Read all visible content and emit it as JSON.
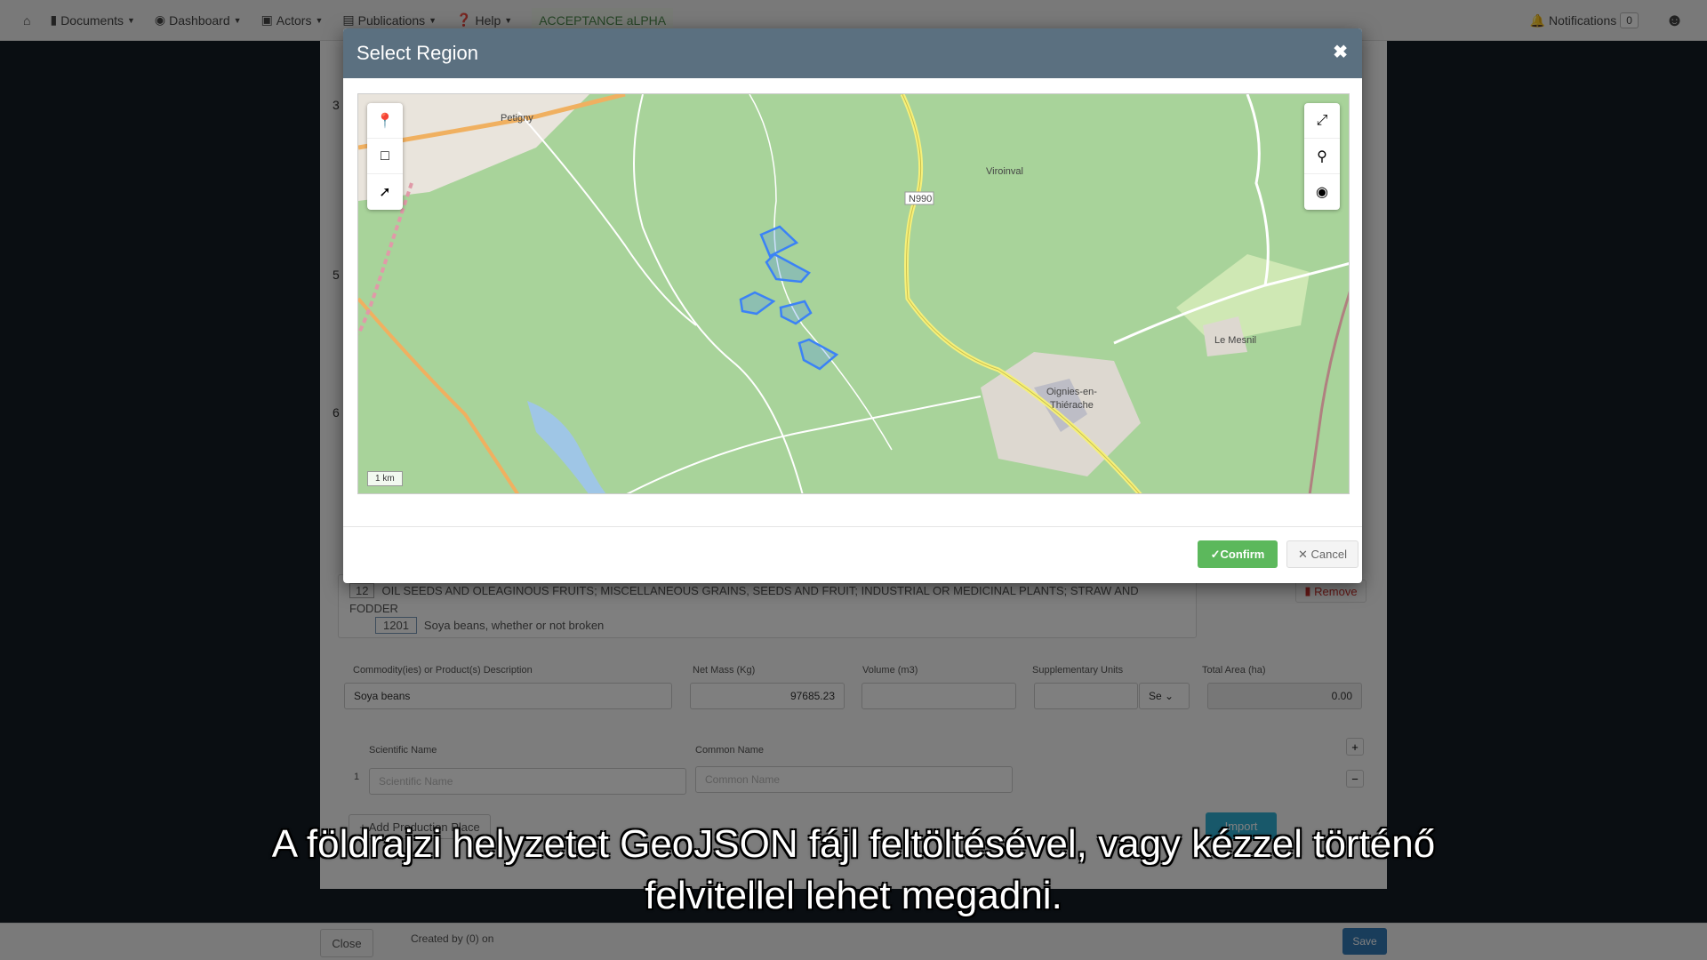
{
  "navbar": {
    "items": [
      {
        "label": "Documents",
        "icon": "file-icon"
      },
      {
        "label": "Dashboard",
        "icon": "dashboard-icon"
      },
      {
        "label": "Actors",
        "icon": "id-card-icon"
      },
      {
        "label": "Publications",
        "icon": "book-icon"
      },
      {
        "label": "Help",
        "icon": "question-icon"
      }
    ],
    "environment": "ACCEPTANCE aLPHA",
    "notifications_label": "Notifications",
    "notifications_count": "0"
  },
  "form": {
    "row_numbers": [
      "3",
      "5",
      "6"
    ],
    "hs_chapter_code": "12",
    "hs_chapter_text": "OIL SEEDS AND OLEAGINOUS FRUITS; MISCELLANEOUS GRAINS, SEEDS AND FRUIT; INDUSTRIAL OR MEDICINAL PLANTS; STRAW AND FODDER",
    "hs_heading_code": "1201",
    "hs_heading_text": "Soya beans, whether or not broken",
    "remove_label": "Remove",
    "labels": {
      "description": "Commodity(ies) or Product(s) Description",
      "net_mass": "Net Mass (Kg)",
      "volume": "Volume (m3)",
      "supplementary_units": "Supplementary Units",
      "total_area": "Total Area (ha)"
    },
    "values": {
      "description": "Soya beans",
      "net_mass": "97685.23",
      "volume": "",
      "supplementary_units": "",
      "supplementary_select": "Se",
      "total_area": "0.00"
    },
    "species": {
      "scientific_header": "Scientific Name",
      "common_header": "Common Name",
      "row_index": "1",
      "scientific_placeholder": "Scientific Name",
      "common_placeholder": "Common Name"
    },
    "add_place_label": "+ Add Production Place",
    "import_label": "Import"
  },
  "bottombar": {
    "close_label": "Close",
    "created_by": "Created by (0) on",
    "save_label": "Save"
  },
  "modal": {
    "title": "Select Region",
    "confirm_label": "Confirm",
    "cancel_label": "Cancel",
    "map": {
      "labels": {
        "petigny": "Petigny",
        "viroinval": "Viroinval",
        "road": "N990",
        "le_mesnil": "Le Mesnil",
        "oignies1": "Oignies-en-",
        "oignies2": "Thiérache"
      },
      "scale": "1 km",
      "polygon_color": "#3b82f6",
      "tools_left": [
        "marker-icon",
        "draw-polygon-icon",
        "draw-line-icon"
      ],
      "tools_right": [
        "fullscreen-icon",
        "search-icon",
        "eye-icon"
      ]
    }
  },
  "subtitle": {
    "line1": "A földrajzi helyzetet GeoJSON fájl feltöltésével, vagy kézzel történő",
    "line2": "felvitellel lehet megadni."
  }
}
